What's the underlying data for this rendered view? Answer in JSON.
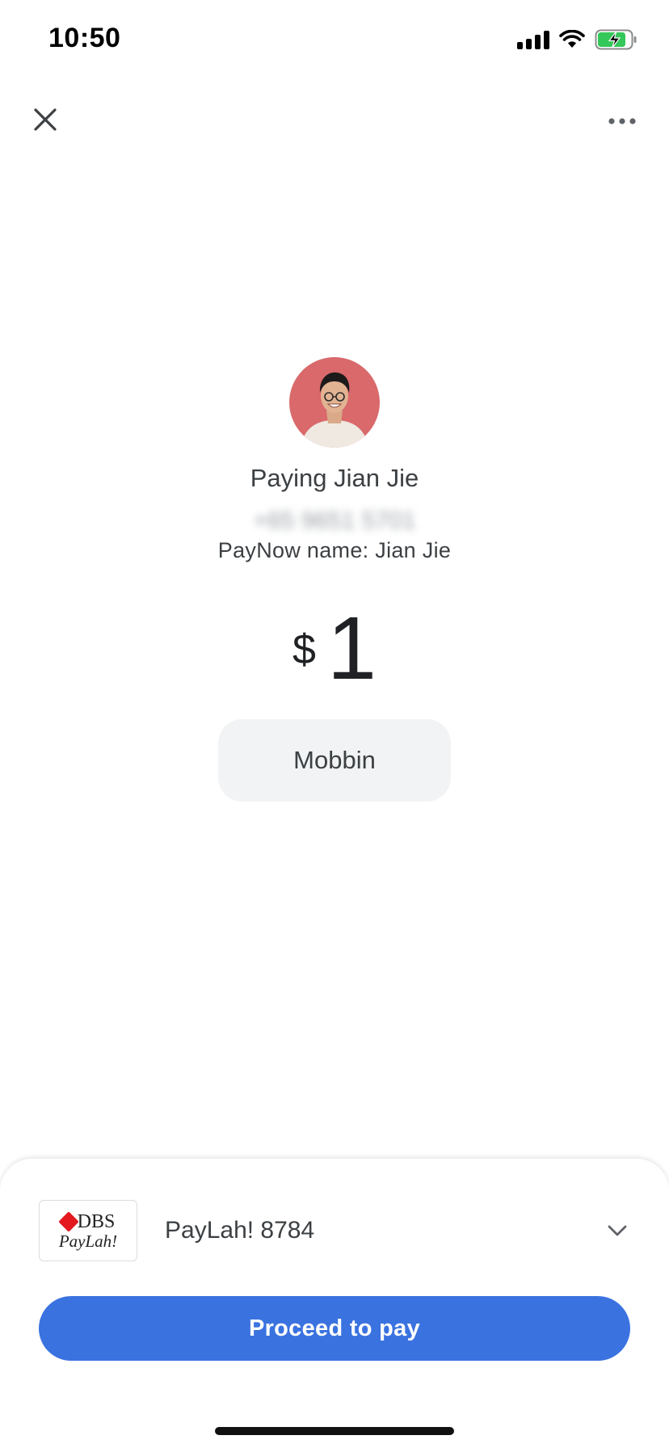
{
  "status_bar": {
    "time": "10:50",
    "icons": [
      "signal-icon",
      "wifi-icon",
      "battery-charging-icon"
    ]
  },
  "header": {
    "close_icon": "close-icon",
    "more_icon": "more-horizontal-icon"
  },
  "payee": {
    "title": "Paying Jian Jie",
    "phone": "+65 9651 5701",
    "paynow_name": "PayNow name: Jian Jie"
  },
  "amount": {
    "currency": "$",
    "value": "1"
  },
  "note": {
    "label": "Mobbin"
  },
  "payment_method": {
    "logo_top": "DBS",
    "logo_bottom": "PayLah!",
    "label": "PayLah! 8784",
    "dropdown_icon": "chevron-down-icon"
  },
  "action": {
    "proceed_label": "Proceed to pay"
  },
  "colors": {
    "primary": "#3a72e0",
    "chip_bg": "#f1f3f4",
    "avatar_bg": "#d9696b",
    "dbs_red": "#e3191f"
  }
}
